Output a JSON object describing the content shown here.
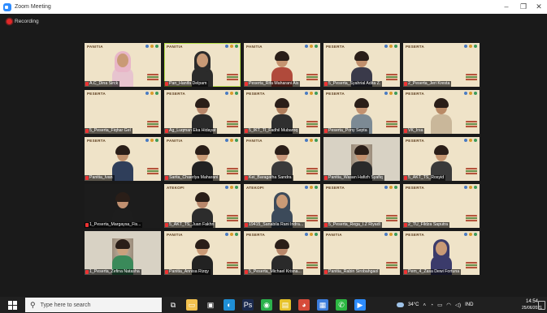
{
  "window": {
    "title": "Zoom Meeting",
    "controls": {
      "minimize": "–",
      "restore": "❐",
      "close": "✕"
    }
  },
  "recording": {
    "label": "Recording",
    "color": "#e02828"
  },
  "participants": [
    {
      "name": "A.C_Dina Sirck",
      "banner": "PANITIA",
      "style": "hijab",
      "tone": "#c99a76",
      "hijab": "#e8b6c8",
      "shirt": "#e7c4cf"
    },
    {
      "name": "Pan_Hanifa Delpam",
      "banner": "PANITIA",
      "style": "hijab",
      "tone": "#c99a76",
      "hijab": "#2b2b2b",
      "shirt": "#2b2b2b",
      "active": true
    },
    {
      "name": "Peserta_Rifa Maharani Ais",
      "banner": "PANITIA",
      "style": "hair",
      "tone": "#c59470",
      "shirt": "#b04a3b"
    },
    {
      "name": "5_Peserta_Syahrial Adita Z.",
      "banner": "PESERTA",
      "style": "hair",
      "tone": "#c08f6c",
      "shirt": "#3a3a4a"
    },
    {
      "name": "2_Peserta_Jeri Kresta",
      "banner": "PESERTA",
      "style": "none"
    },
    {
      "name": "5_Peserta_Fiqhar Gel",
      "banner": "PESERTA",
      "style": "none"
    },
    {
      "name": "Ag_Luqman Eka Hidayat",
      "banner": "PESERTA",
      "style": "hair",
      "tone": "#b8876a",
      "shirt": "#2a2a2a"
    },
    {
      "name": "5_IKT_TI_Fadhil Mubaroq",
      "banner": "PESERTA",
      "style": "hair",
      "tone": "#b07e5c",
      "shirt": "#2f2f2f"
    },
    {
      "name": "Peserta_Pony Septa",
      "banner": "PESERTA",
      "style": "hair",
      "tone": "#c39270",
      "shirt": "#7c8a94"
    },
    {
      "name": "VK_Irsa",
      "banner": "PESERTA",
      "style": "hair",
      "tone": "#b98a66",
      "shirt": "#c9b79a"
    },
    {
      "name": "Panitia_Ivan",
      "banner": "PESERTA",
      "style": "hair",
      "tone": "#c0916d",
      "shirt": "#2f3e5a"
    },
    {
      "name": "Sarita_Chaerlya Maharani",
      "banner": "PANITIA",
      "style": "hair",
      "tone": "#c99a76",
      "shirt": "#222222"
    },
    {
      "name": "Kei_Baragatha Sandra",
      "banner": "PANITIA",
      "style": "hair",
      "tone": "#c7967a",
      "shirt": "#3a3a3a"
    },
    {
      "name": "Panitia_Wasan Hafizh Syafiq",
      "banner": "PESERTA",
      "style": "hair",
      "tone": "#c08e6c",
      "shirt": "#2a2a2a",
      "room": true
    },
    {
      "name": "5_AKT_TS_Rosyid",
      "banner": "PESERTA",
      "style": "hair",
      "tone": "#c59570",
      "shirt": "#3a3a3a"
    },
    {
      "name": "1_Peserta_Margaysa_Fis...",
      "banner": "PESERTA",
      "style": "hair",
      "tone": "#c09070",
      "shirt": "#1d1d1d",
      "dark": true
    },
    {
      "name": "5_AKT_TS_Juan Fakhri",
      "banner": "ATEKOPI",
      "style": "hair",
      "tone": "#b8876a",
      "shirt": "#2c2c2c"
    },
    {
      "name": "19415_Sanabila Rani Indra...",
      "banner": "ATEKOPI",
      "style": "hijab",
      "tone": "#c99a76",
      "hijab": "#3c4a5a",
      "shirt": "#3c4a5a"
    },
    {
      "name": "5_Peserta_Rega_I.Z Riyadi",
      "banner": "PESERTA",
      "style": "none"
    },
    {
      "name": "2_TU_Fildza Saputra",
      "banner": "PESERTA",
      "style": "none"
    },
    {
      "name": "1_Peserta_Zefina Natasha",
      "banner": "PANITIA",
      "style": "hair",
      "tone": "#caa07c",
      "shirt": "#3a8a5a",
      "room": true
    },
    {
      "name": "Panitia_Annisa Rizqy",
      "banner": "PANITIA",
      "style": "hair",
      "tone": "#c99a76",
      "shirt": "#222222"
    },
    {
      "name": "5_Peserta_Michael Krisna...",
      "banner": "PESERTA",
      "style": "hair",
      "tone": "#b8876a",
      "shirt": "#2a2a2a"
    },
    {
      "name": "Panitia_Rabin Sirobahgaol",
      "banner": "PANITIA",
      "style": "none"
    },
    {
      "name": "Pem_4_Zasa Dewi Fortuna",
      "banner": "PESERTA",
      "style": "hijab",
      "tone": "#c99a76",
      "hijab": "#3b3b6b",
      "shirt": "#3b3b6b"
    }
  ],
  "taskbar": {
    "search_placeholder": "Type here to search",
    "pinned": [
      {
        "icon": "task-view-icon",
        "glyph": "⧉",
        "color": "#202020"
      },
      {
        "icon": "file-explorer-icon",
        "glyph": "▭",
        "color": "#f2c14e"
      },
      {
        "icon": "store-icon",
        "glyph": "▣",
        "color": "#202020"
      },
      {
        "icon": "edge-icon",
        "glyph": "◐",
        "color": "#1f8fd6"
      },
      {
        "icon": "photoshop-icon",
        "glyph": "Ps",
        "color": "#1b2a4e"
      },
      {
        "icon": "line-icon",
        "glyph": "◉",
        "color": "#2bb24c"
      },
      {
        "icon": "sticky-notes-icon",
        "glyph": "▤",
        "color": "#e6c229"
      },
      {
        "icon": "chrome-icon",
        "glyph": "◕",
        "color": "#d64b3a"
      },
      {
        "icon": "files-icon",
        "glyph": "▦",
        "color": "#3b7ddd"
      },
      {
        "icon": "whatsapp-icon",
        "glyph": "✆",
        "color": "#2cb742"
      },
      {
        "icon": "zoom-icon",
        "glyph": "▶",
        "color": "#2d8cff"
      }
    ],
    "weather": "34°C",
    "language": "IND",
    "time": "14:54",
    "date": "25/06/2021"
  }
}
